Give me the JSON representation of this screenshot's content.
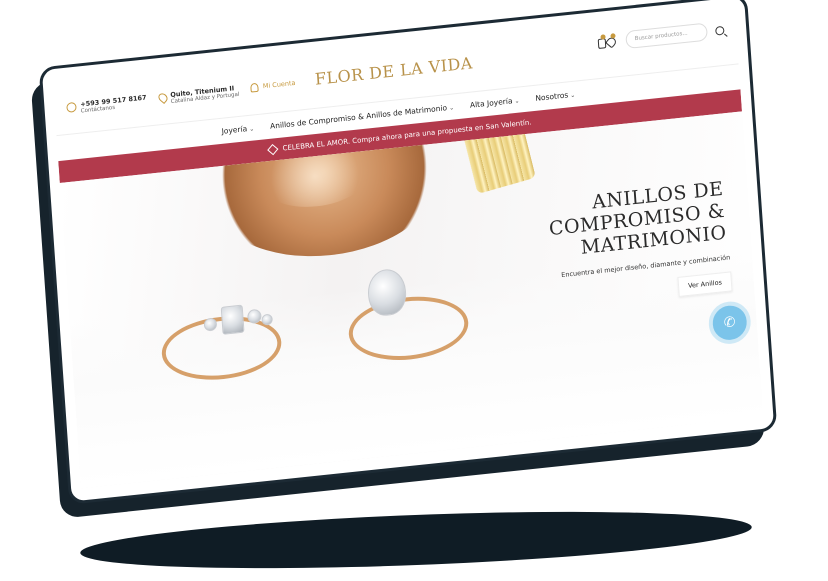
{
  "contact": {
    "phone": "+593 99 517 8167",
    "phone_sub": "Contáctanos",
    "location_main": "Quito, Titenium II",
    "location_sub": "Catalina Aldaz y Portugal",
    "account": "Mi Cuenta"
  },
  "brand": {
    "logo": "FLOR DE LA VIDA"
  },
  "search": {
    "placeholder": "Buscar productos..."
  },
  "nav": {
    "items": [
      {
        "label": "Joyería"
      },
      {
        "label": "Anillos de Compromiso & Anillos de Matrimonio"
      },
      {
        "label": "Alta Joyería"
      },
      {
        "label": "Nosotros"
      }
    ]
  },
  "banner": {
    "text": "CELEBRA EL AMOR. Compra ahora para una propuesta en San Valentín."
  },
  "hero": {
    "title_line1": "ANILLOS DE",
    "title_line2": "COMPROMISO &",
    "title_line3": "MATRIMONIO",
    "subtitle": "Encuentra el mejor diseño, diamante y combinación",
    "button": "Ver Anillos"
  },
  "colors": {
    "accent_gold": "#c79a3f",
    "banner_red": "#b23a4c",
    "call_blue": "#7bc4ea"
  },
  "icons": [
    "phone-icon",
    "location-pin-icon",
    "user-icon",
    "shopping-bag-icon",
    "wishlist-heart-icon",
    "search-icon",
    "diamond-icon",
    "phone-call-icon"
  ]
}
